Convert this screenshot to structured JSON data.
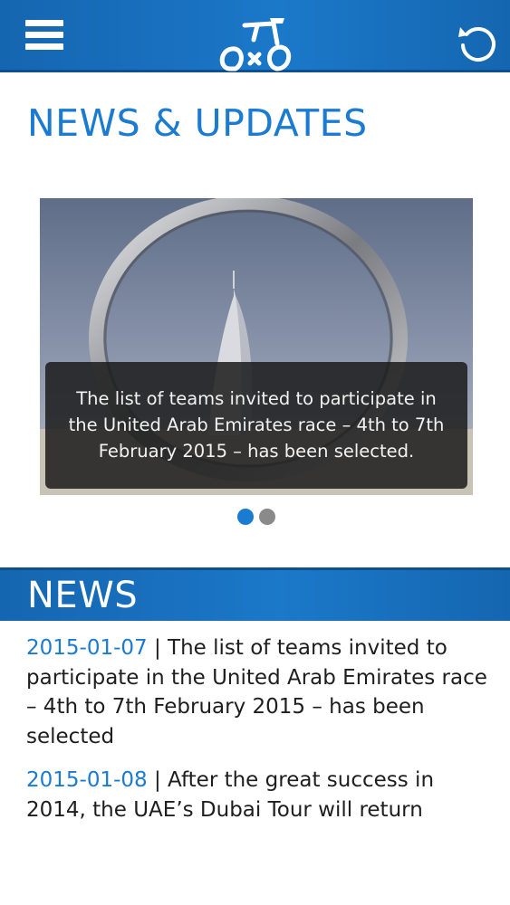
{
  "header": {
    "menu_icon": "hamburger-menu-icon",
    "logo_icon": "bicycle-logo-icon",
    "refresh_icon": "refresh-icon",
    "brand_color": "#1b7bd0"
  },
  "page_title": "NEWS & UPDATES",
  "slider": {
    "caption": "The list of teams invited to participate in the United Arab Emirates race – 4th to 7th February 2015 – has been selected.",
    "slide_count": 2,
    "active_slide": 1
  },
  "news_section": {
    "title": "NEWS",
    "separator": " | ",
    "items": [
      {
        "date": "2015-01-07",
        "text": "The list of teams invited to participate in the United Arab Emirates race – 4th to 7th February 2015 – has been selected"
      },
      {
        "date": "2015-01-08",
        "text": "After the great success in 2014, the UAE’s Dubai Tour will return"
      }
    ]
  }
}
